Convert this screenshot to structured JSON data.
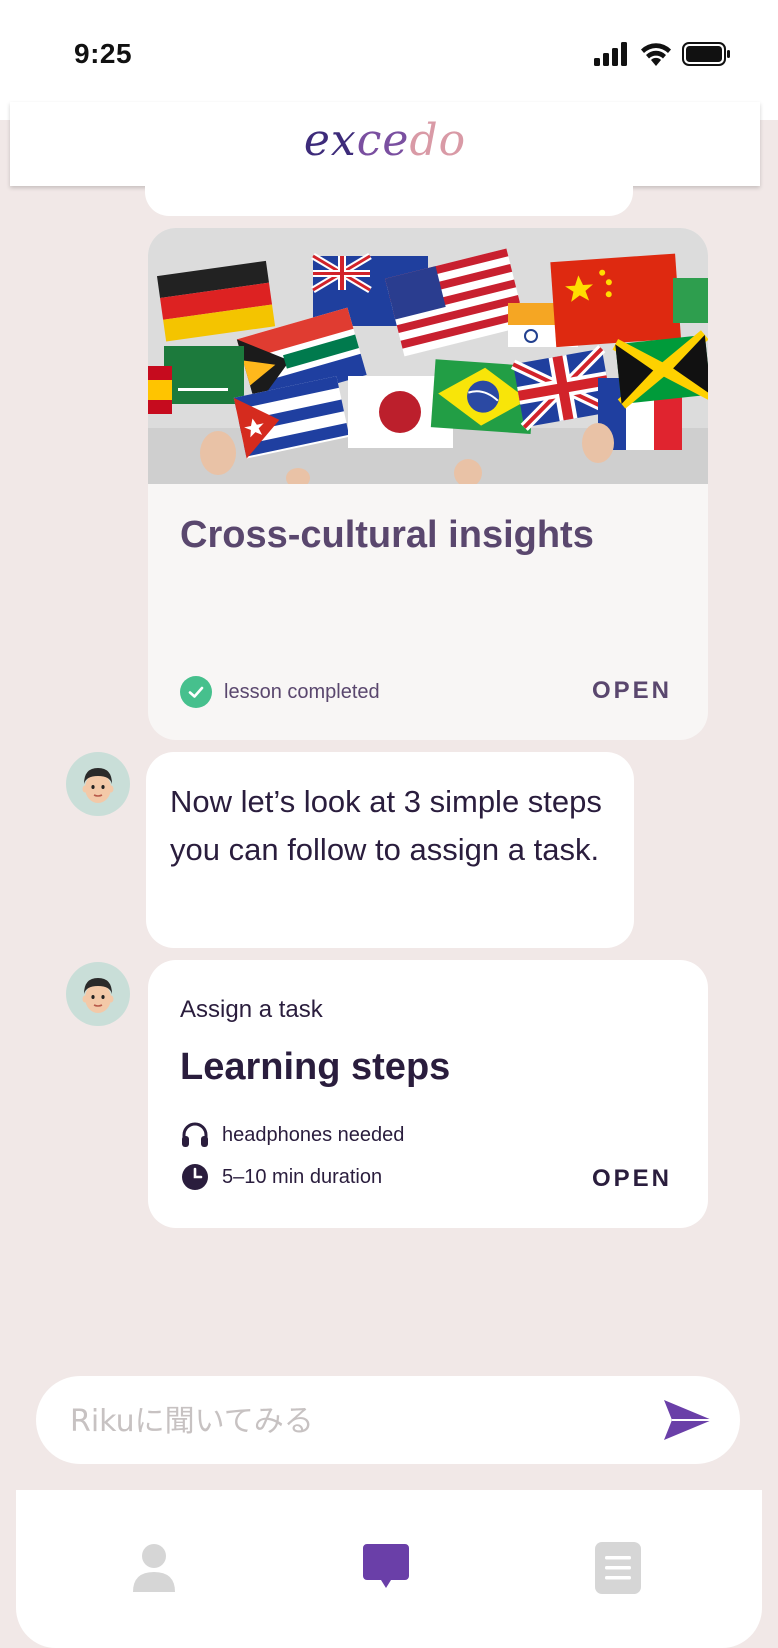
{
  "status_bar": {
    "time": "9:25"
  },
  "header": {
    "logo_part1": "ex",
    "logo_part2": "ce",
    "logo_part3": "do"
  },
  "lesson_card": {
    "title": "Cross-cultural insights",
    "status": "lesson completed",
    "open_label": "OPEN"
  },
  "message": {
    "text": "Now let’s look at 3 simple steps you can follow to assign a task."
  },
  "task_card": {
    "subtitle": "Assign a task",
    "title": "Learning steps",
    "requirement": "headphones needed",
    "duration": "5–10 min duration",
    "open_label": "OPEN"
  },
  "input": {
    "placeholder": "Rikuに聞いてみる"
  },
  "colors": {
    "accent": "#6a3fa8",
    "success": "#46c08d",
    "background": "#f1e8e7"
  },
  "tab_bar": {
    "tabs": [
      "profile-icon",
      "chat-icon",
      "list-icon"
    ],
    "active": "chat-icon"
  }
}
